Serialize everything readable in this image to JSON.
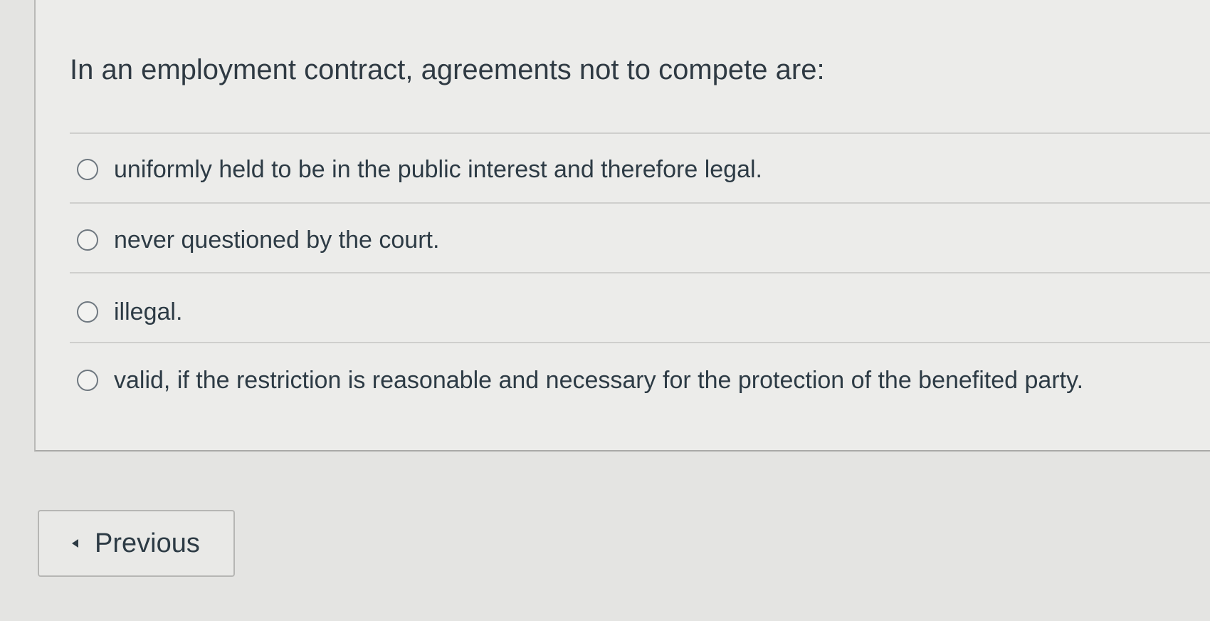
{
  "question": {
    "text": "In an employment contract, agreements not to compete are:"
  },
  "answers": [
    {
      "label": "uniformly held to be in the public interest and therefore legal.",
      "selected": false
    },
    {
      "label": "never questioned by the court.",
      "selected": false
    },
    {
      "label": "illegal.",
      "selected": false
    },
    {
      "label": "valid, if the restriction is reasonable and necessary for the protection of the benefited party.",
      "selected": false
    }
  ],
  "navigation": {
    "previous_label": "Previous",
    "previous_icon": "caret-left-icon"
  }
}
